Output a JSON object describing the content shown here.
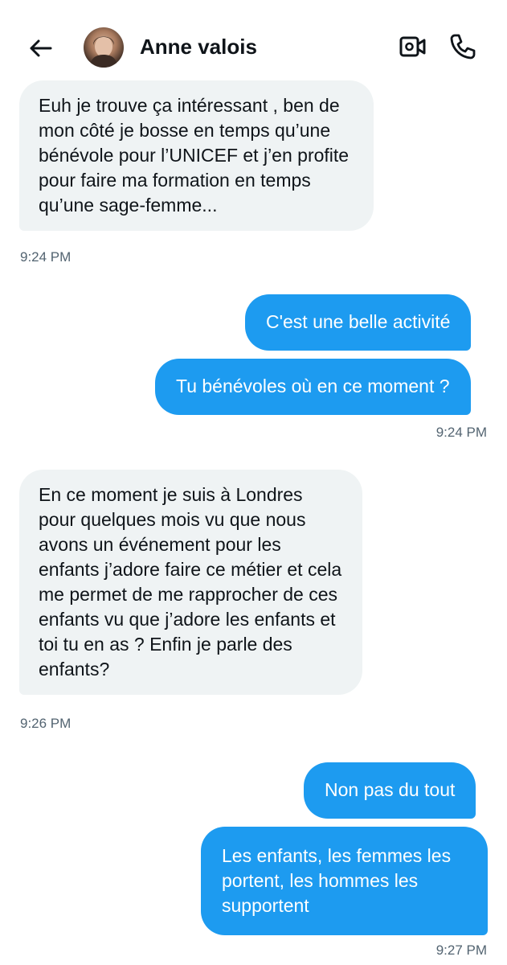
{
  "header": {
    "contact_name": "Anne valois",
    "back_icon": "arrow-left-icon",
    "video_icon": "video-camera-icon",
    "phone_icon": "phone-icon"
  },
  "colors": {
    "outgoing_bubble": "#1d9bf0",
    "incoming_bubble": "#eff3f4",
    "timestamp": "#536471"
  },
  "messages": [
    {
      "direction": "incoming",
      "text": "Euh je trouve ça intéressant , ben de mon côté je bosse en temps qu’une bénévole pour l’UNICEF et j’en profite pour faire ma formation en temps qu’une sage-femme..."
    },
    {
      "direction": "outgoing",
      "text": "C'est une belle activité"
    },
    {
      "direction": "outgoing",
      "text": "Tu bénévoles où en ce moment ?"
    },
    {
      "direction": "incoming",
      "text": "En ce moment je suis à Londres pour quelques mois vu que nous avons un événement pour les enfants j’adore faire ce métier et cela me permet de me rapprocher de ces enfants vu que j’adore les enfants et toi tu en as ? Enfin je parle des enfants?"
    },
    {
      "direction": "outgoing",
      "text": "Non pas du tout"
    },
    {
      "direction": "outgoing",
      "text": "Les enfants, les femmes les portent, les hommes les supportent"
    }
  ],
  "timestamps": [
    "9:24 PM",
    "9:24 PM",
    "9:26 PM",
    "9:27 PM"
  ]
}
